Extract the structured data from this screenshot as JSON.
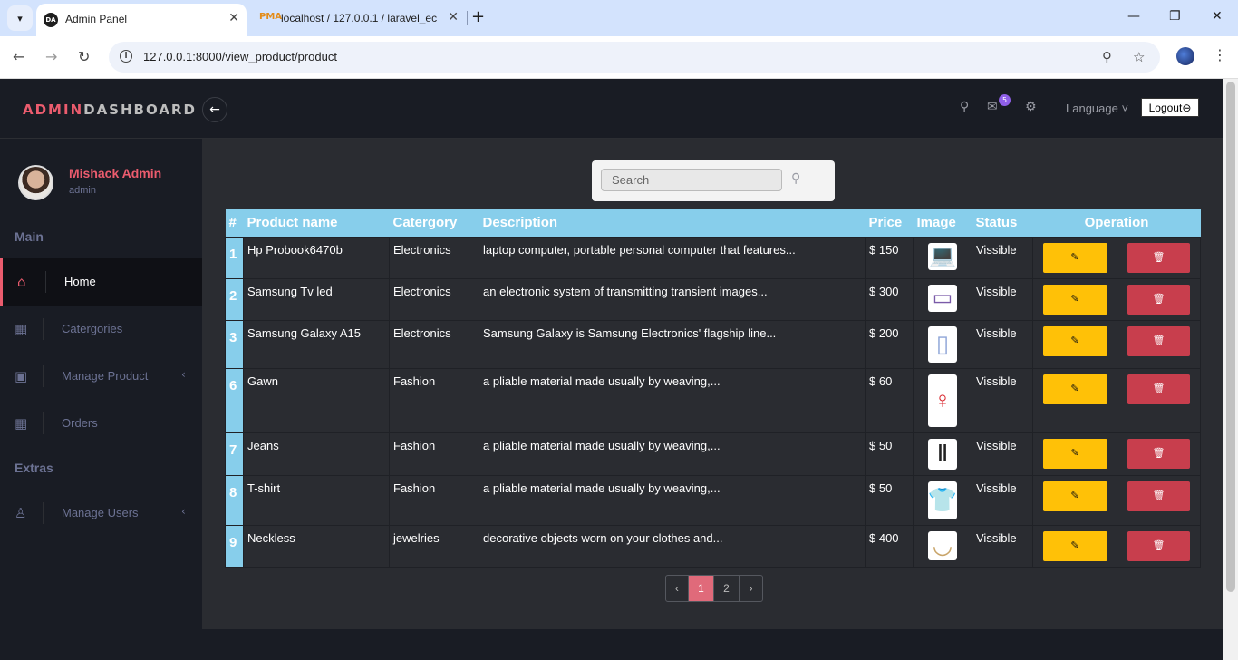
{
  "browser": {
    "tabs": [
      {
        "favicon": "DA",
        "title": "Admin Panel"
      },
      {
        "favicon": "PMA",
        "title": "localhost / 127.0.0.1 / laravel_ec"
      }
    ],
    "url": "127.0.0.1:8000/view_product/product"
  },
  "header": {
    "brand_part1": "ADMIN",
    "brand_part2": "DASHBOARD",
    "mail_badge": "5",
    "language": "Language",
    "logout": "Logout"
  },
  "sidebar": {
    "user_name": "Mishack Admin",
    "user_role": "admin",
    "section_main": "Main",
    "section_extras": "Extras",
    "items": [
      {
        "label": "Home"
      },
      {
        "label": "Catergories"
      },
      {
        "label": "Manage Product"
      },
      {
        "label": "Orders"
      },
      {
        "label": "Manage Users"
      }
    ]
  },
  "search": {
    "placeholder": "Search"
  },
  "table": {
    "headers": [
      "#",
      "Product name",
      "Catergory",
      "Description",
      "Price",
      "Image",
      "Status",
      "Operation"
    ],
    "rows": [
      {
        "id": "1",
        "name": "Hp Probook6470b",
        "category": "Electronics",
        "description": "laptop computer, portable personal computer that features...",
        "price": "$ 150",
        "image": "laptop-image",
        "status": "Vissible"
      },
      {
        "id": "2",
        "name": "Samsung Tv led",
        "category": "Electronics",
        "description": "an electronic system of transmitting transient images...",
        "price": "$ 300",
        "image": "tv-image",
        "status": "Vissible"
      },
      {
        "id": "3",
        "name": "Samsung Galaxy A15",
        "category": "Electronics",
        "description": "Samsung Galaxy is Samsung Electronics' flagship line...",
        "price": "$ 200",
        "image": "phone-image",
        "status": "Vissible"
      },
      {
        "id": "6",
        "name": "Gawn",
        "category": "Fashion",
        "description": "a pliable material made usually by weaving,...",
        "price": "$ 60",
        "image": "dress-image",
        "status": "Vissible"
      },
      {
        "id": "7",
        "name": "Jeans",
        "category": "Fashion",
        "description": "a pliable material made usually by weaving,...",
        "price": "$ 50",
        "image": "jeans-image",
        "status": "Vissible"
      },
      {
        "id": "8",
        "name": "T-shirt",
        "category": "Fashion",
        "description": "a pliable material made usually by weaving,...",
        "price": "$ 50",
        "image": "tshirt-image",
        "status": "Vissible"
      },
      {
        "id": "9",
        "name": "Neckless",
        "category": "jewelries",
        "description": "decorative objects worn on your clothes and...",
        "price": "$ 400",
        "image": "necklace-image",
        "status": "Vissible"
      }
    ]
  },
  "pagination": {
    "prev": "‹",
    "pages": [
      "1",
      "2"
    ],
    "current": "1",
    "next": "›"
  },
  "colors": {
    "accent": "#eb5c6e",
    "table_header": "#87ceeb",
    "edit": "#ffc107",
    "delete": "#c83e4d"
  }
}
